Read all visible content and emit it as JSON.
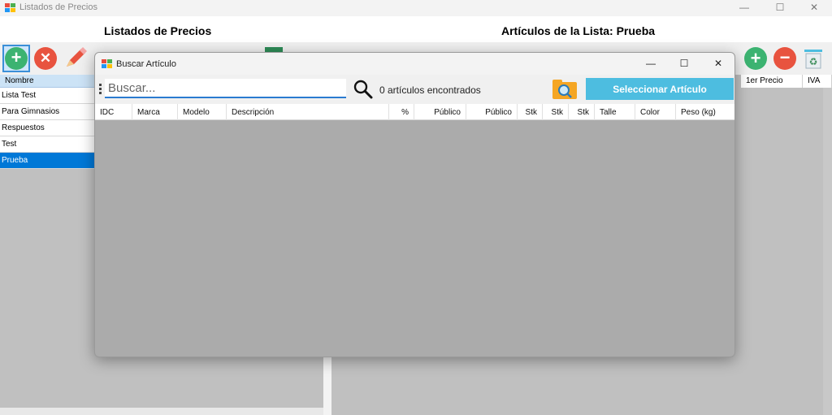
{
  "main_window": {
    "title": "Listados de Precios",
    "controls": {
      "minimize": "—",
      "maximize": "☐",
      "close": "✕"
    }
  },
  "header": {
    "left_title": "Listados de Precios",
    "right_title": "Artículos de la Lista: Prueba"
  },
  "left_list": {
    "column_header": "Nombre",
    "items": [
      "Lista Test",
      "Para Gimnasios",
      "Respuestos",
      "Test",
      "Prueba"
    ],
    "selected_index": 4
  },
  "right_table": {
    "headers": [
      "1er Precio",
      "IVA"
    ]
  },
  "dialog": {
    "title": "Buscar Artículo",
    "controls": {
      "minimize": "—",
      "maximize": "☐",
      "close": "✕"
    },
    "search": {
      "placeholder": "Buscar...",
      "value": ""
    },
    "count_label": "0 artículos encontrados",
    "select_button": "Seleccionar Artículo",
    "grid_headers": [
      "IDC",
      "Marca",
      "Modelo",
      "Descripción",
      "%",
      "Público",
      "Público",
      "Stk",
      "Stk",
      "Stk",
      "Talle",
      "Color",
      "Peso (kg)"
    ]
  },
  "colors": {
    "accent": "#4dbde0",
    "selection": "#0078d7",
    "add_green": "#3cb371",
    "delete_red": "#e8533f"
  }
}
